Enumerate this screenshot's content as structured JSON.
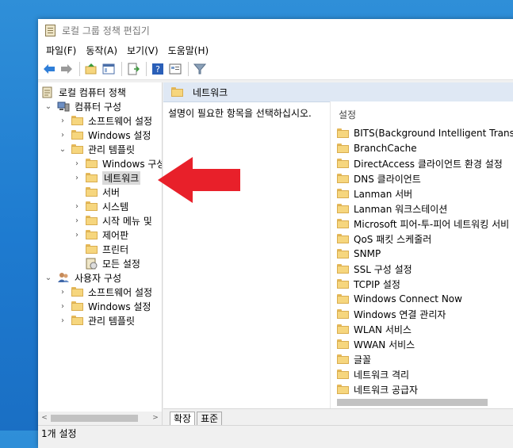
{
  "window": {
    "title": "로컬 그룹 정책 편집기"
  },
  "menu": [
    "파일(F)",
    "동작(A)",
    "보기(V)",
    "도움말(H)"
  ],
  "tree": {
    "root": "로컬 컴퓨터 정책",
    "computer_config": "컴퓨터 구성",
    "software_settings": "소프트웨어 설정",
    "windows_settings": "Windows 설정",
    "admin_templates": "관리 템플릿",
    "windows_components": "Windows 구성",
    "network": "네트워크",
    "server": "서버",
    "system": "시스템",
    "start_menu": "시작 메뉴 및",
    "control_panel": "제어판",
    "printers": "프린터",
    "all_settings": "모든 설정",
    "user_config": "사용자 구성",
    "user_software_settings": "소프트웨어 설정",
    "user_windows_settings": "Windows 설정",
    "user_admin_templates": "관리 템플릿"
  },
  "content": {
    "header": "네트워크",
    "description": "설명이 필요한 항목을 선택하십시오.",
    "column_header": "설정",
    "items": [
      "BITS(Background Intelligent Transfer S",
      "BranchCache",
      "DirectAccess 클라이언트 환경 설정",
      "DNS 클라이언트",
      "Lanman 서버",
      "Lanman 워크스테이션",
      "Microsoft 피어-투-피어 네트워킹 서비",
      "QoS 패킷 스케줄러",
      "SNMP",
      "SSL 구성 설정",
      "TCPIP 설정",
      "Windows Connect Now",
      "Windows 연결 관리자",
      "WLAN 서비스",
      "WWAN 서비스",
      "글꼴",
      "네트워크 격리",
      "네트워크 공급자"
    ]
  },
  "tabs": [
    "확장",
    "표준"
  ],
  "status": "1개 설정",
  "colors": {
    "arrow": "#e8202a",
    "header_bg": "#dfe8f4",
    "selected_bg": "#d9d9d9"
  }
}
